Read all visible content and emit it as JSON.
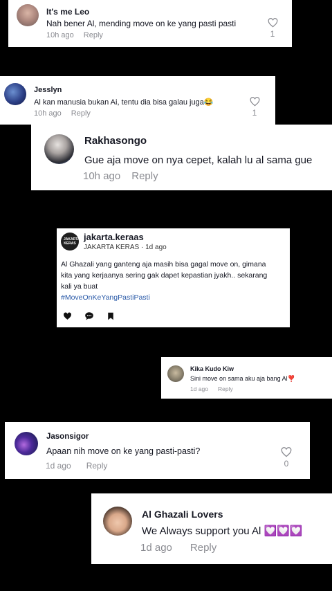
{
  "comments": [
    {
      "username": "It's me Leo",
      "text": "Nah bener Al, mending move on ke yang pasti pasti",
      "time": "10h ago",
      "reply": "Reply",
      "likes": "1"
    },
    {
      "username": "Jesslyn",
      "text": "Al kan manusia bukan Ai, tentu dia bisa galau juga😂",
      "time": "10h ago",
      "reply": "Reply",
      "likes": "1"
    },
    {
      "username": "Rakhasongo",
      "text": "Gue aja move on nya cepet, kalah lu al sama gue",
      "time": "10h ago",
      "reply": "Reply"
    },
    {
      "username": "Kika Kudo Kiw",
      "text": "Sini move on sama aku aja bang Al❣️",
      "time": "1d ago",
      "reply": "Reply"
    },
    {
      "username": "Jasonsigor",
      "text": "Apaan nih move on ke yang pasti-pasti?",
      "time": "1d ago",
      "reply": "Reply",
      "likes": "0"
    },
    {
      "username": "Al Ghazali Lovers",
      "text": "We Always support you Al 💟💟💟",
      "time": "1d ago",
      "reply": "Reply"
    }
  ],
  "post": {
    "username": "jakarta.keraas",
    "subtitle": "JAKARTA KERAS · 1d ago",
    "avatar_text": "JAKARTA KERAS",
    "caption": [
      "Al Ghazali yang ganteng aja masih bisa gagal move on, gimana",
      "kita yang kerjaanya sering gak dapet kepastian jyakh.. sekarang",
      "kali ya buat"
    ],
    "hashtag": "#MoveOnKeYangPastiPasti",
    "actions": [
      "heart-icon",
      "comment-icon",
      "bookmark-icon"
    ]
  }
}
